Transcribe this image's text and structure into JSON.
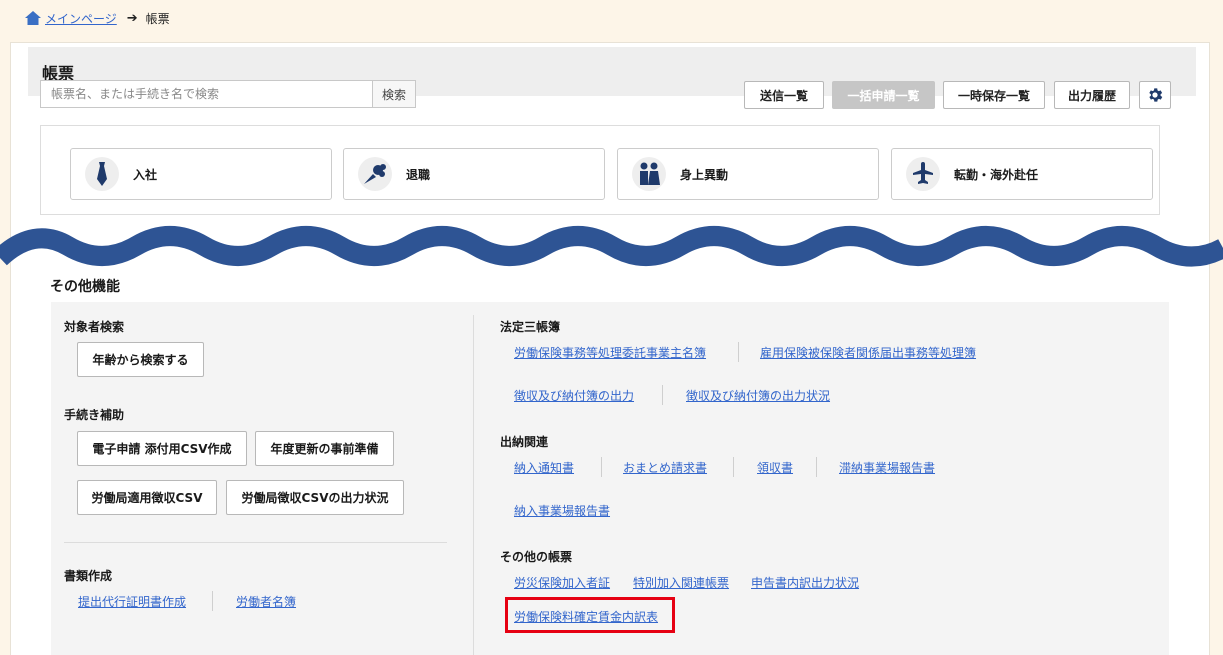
{
  "breadcrumb": {
    "home": "メインページ",
    "current": "帳票"
  },
  "page_title": "帳票",
  "search": {
    "placeholder": "帳票名、または手続き名で検索",
    "button": "検索"
  },
  "toolbar": {
    "sent_list": "送信一覧",
    "batch_list": "一括申請一覧",
    "temp_saved_list": "一時保存一覧",
    "output_history": "出力履歴",
    "settings_icon": "gear-icon"
  },
  "categories": [
    {
      "label": "入社",
      "icon": "necktie-icon"
    },
    {
      "label": "退職",
      "icon": "bouquet-icon"
    },
    {
      "label": "身上異動",
      "icon": "couple-icon"
    },
    {
      "label": "転勤・海外赴任",
      "icon": "airplane-icon"
    }
  ],
  "other": {
    "title": "その他機能",
    "target_search": {
      "title": "対象者検索",
      "age_search": "年齢から検索する"
    },
    "procedure_help": {
      "title": "手続き補助",
      "csv_create": "電子申請 添付用CSV作成",
      "annual_prep": "年度更新の事前準備",
      "labor_csv": "労働局適用徴収CSV",
      "labor_csv_status": "労働局徴収CSVの出力状況"
    },
    "documents": {
      "title": "書類作成",
      "proxy_cert": "提出代行証明書作成",
      "worker_list": "労働者名簿"
    },
    "legal_books": {
      "title": "法定三帳簿",
      "link1": "労働保険事務等処理委託事業主名簿",
      "link2": "雇用保険被保険者関係届出事務等処理簿",
      "link3": "徴収及び納付簿の出力",
      "link4": "徴収及び納付簿の出力状況"
    },
    "payment": {
      "title": "出納関連",
      "link1": "納入通知書",
      "link2": "おまとめ請求書",
      "link3": "領収書",
      "link4": "滞納事業場報告書",
      "link5": "納入事業場報告書"
    },
    "other_forms": {
      "title": "その他の帳票",
      "link1": "労災保険加入者証",
      "link2": "特別加入関連帳票",
      "link3": "申告書内訳出力状況",
      "link4": "労働保険料確定賃金内訳表"
    }
  },
  "colors": {
    "link": "#3366cc",
    "wave": "#2e5494",
    "highlight": "#e60012",
    "background": "#fdf5e8"
  }
}
